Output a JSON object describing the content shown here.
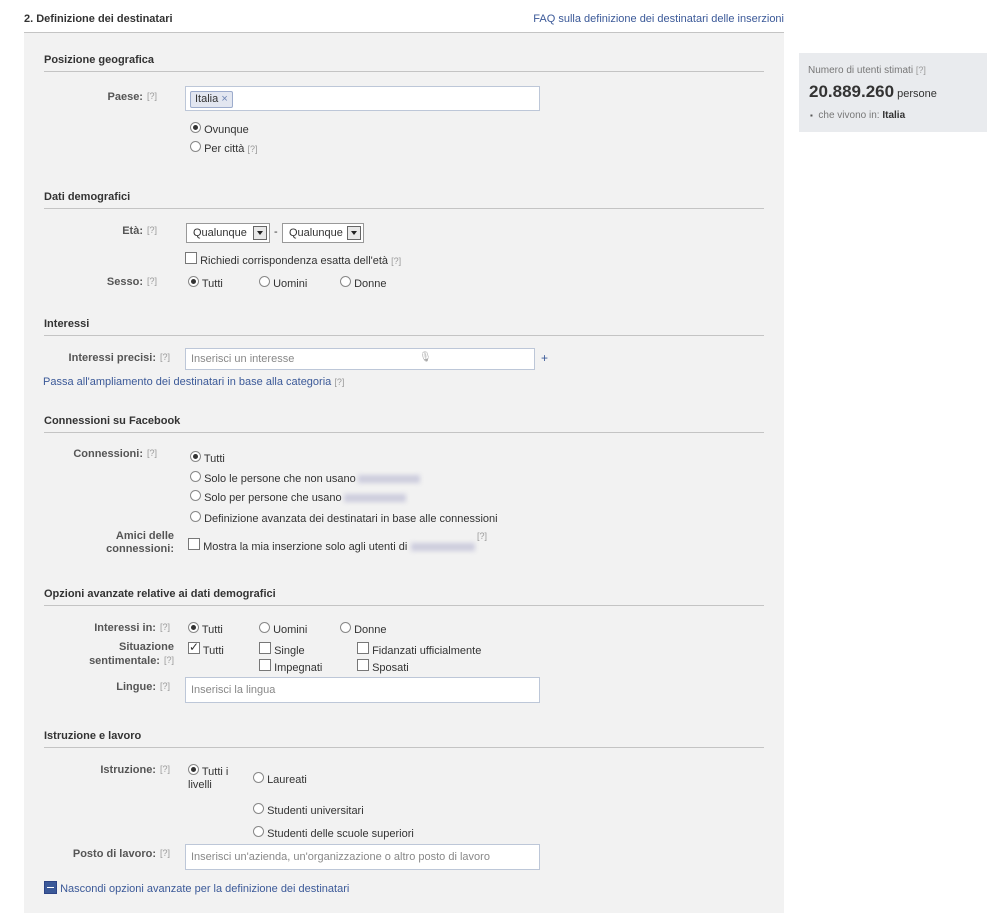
{
  "header": {
    "title": "2. Definizione dei destinatari",
    "faq_link": "FAQ sulla definizione dei destinatari delle inserzioni"
  },
  "help_marker": "[?]",
  "geo": {
    "section": "Posizione geografica",
    "country_label": "Paese:",
    "country_token": "Italia",
    "token_remove": "×",
    "opt_anywhere": "Ovunque",
    "opt_city": "Per città"
  },
  "demo": {
    "section": "Dati demografici",
    "age_label": "Età:",
    "age_min": "Qualunque",
    "age_sep": "-",
    "age_max": "Qualunque",
    "exact_age": "Richiedi corrispondenza esatta dell'età",
    "sex_label": "Sesso:",
    "sex_all": "Tutti",
    "sex_men": "Uomini",
    "sex_women": "Donne"
  },
  "interests": {
    "section": "Interessi",
    "precise_label": "Interessi precisi:",
    "placeholder": "Inserisci un interesse",
    "mic": "🎙",
    "add": "+",
    "broad_link": "Passa all'ampliamento dei destinatari in base alla categoria"
  },
  "connections": {
    "section": "Connessioni su Facebook",
    "label": "Connessioni:",
    "opt_all": "Tutti",
    "opt_not_users": "Solo le persone che non usano",
    "opt_users": "Solo per persone che usano",
    "opt_advanced": "Definizione avanzata dei destinatari in base alle connessioni",
    "friends_label_1": "Amici delle",
    "friends_label_2": "connessioni:",
    "friends_opt": "Mostra la mia inserzione solo agli utenti di"
  },
  "advanced": {
    "section": "Opzioni avanzate relative ai dati demografici",
    "interested_label": "Interessi in:",
    "int_all": "Tutti",
    "int_men": "Uomini",
    "int_women": "Donne",
    "rel_label_1": "Situazione",
    "rel_label_2": "sentimentale:",
    "rel_all": "Tutti",
    "rel_single": "Single",
    "rel_engaged": "Fidanzati ufficialmente",
    "rel_committed": "Impegnati",
    "rel_married": "Sposati",
    "lang_label": "Lingue:",
    "lang_placeholder": "Inserisci la lingua"
  },
  "education": {
    "section": "Istruzione e lavoro",
    "edu_label": "Istruzione:",
    "edu_all_1": "Tutti i",
    "edu_all_2": "livelli",
    "edu_grad": "Laureati",
    "edu_college": "Studenti universitari",
    "edu_highschool": "Studenti delle scuole superiori",
    "work_label": "Posto di lavoro:",
    "work_placeholder": "Inserisci un'azienda, un'organizzazione o altro posto di lavoro",
    "hide_link": "Nascondi opzioni avanzate per la definizione dei destinatari"
  },
  "estimate": {
    "title": "Numero di utenti stimati",
    "count": "20.889.260",
    "unit": "persone",
    "bullet": "▪",
    "living_in": "che vivono in:",
    "country": "Italia"
  }
}
